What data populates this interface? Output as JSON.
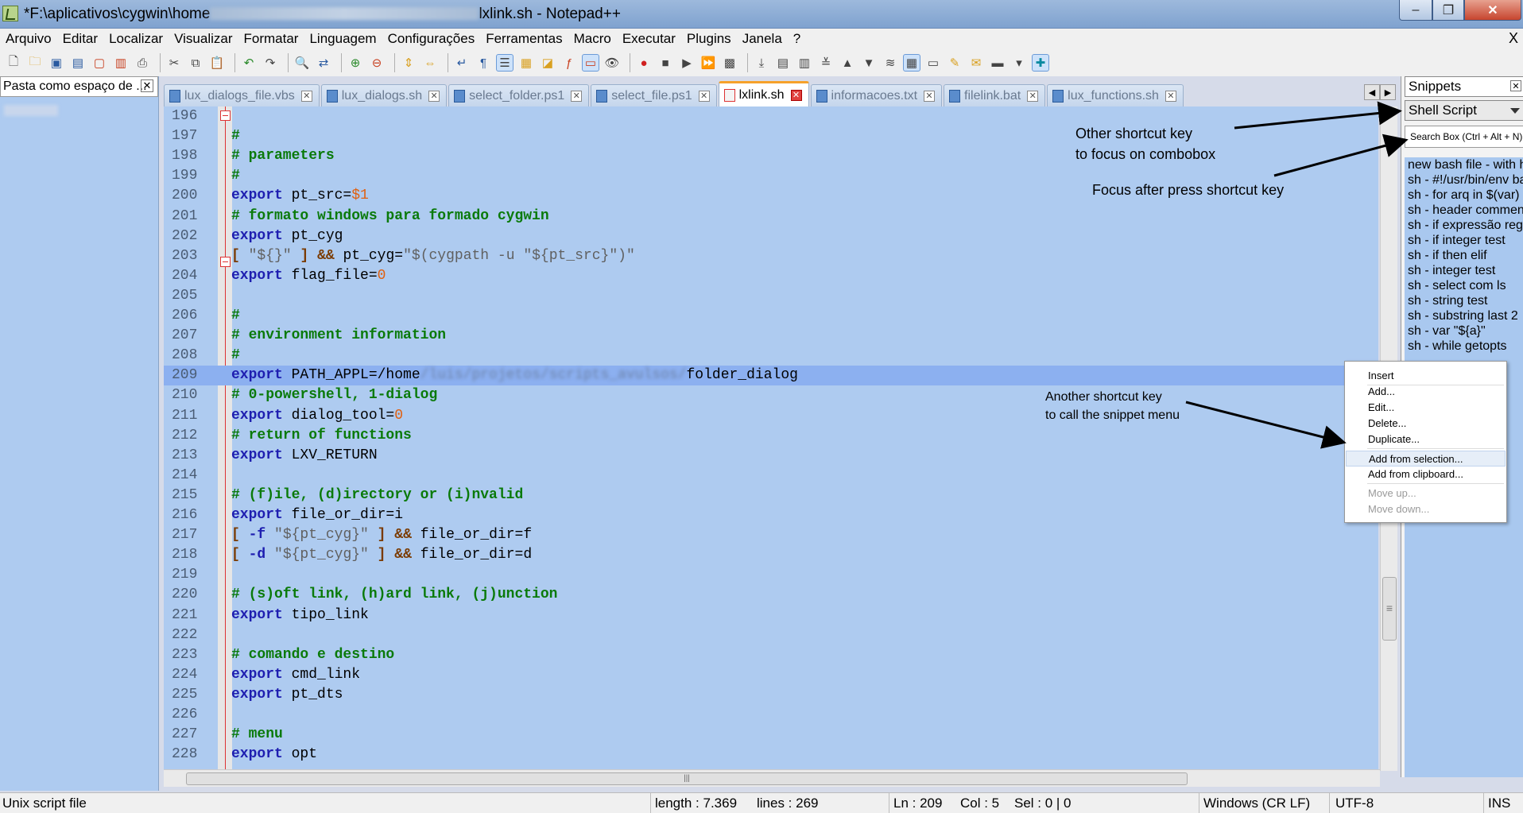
{
  "window": {
    "title_prefix": "*F:\\aplicativos\\cygwin\\home",
    "title_suffix": "lxlink.sh - Notepad++",
    "min": "–",
    "max": "❐",
    "close": "✕"
  },
  "menu": {
    "items": [
      "Arquivo",
      "Editar",
      "Localizar",
      "Visualizar",
      "Formatar",
      "Linguagem",
      "Configurações",
      "Ferramentas",
      "Macro",
      "Executar",
      "Plugins",
      "Janela",
      "?"
    ],
    "close": "X"
  },
  "left_panel": {
    "title": "Pasta como espaço de ...",
    "close": "✕"
  },
  "tabs": [
    {
      "label": "lux_dialogs_file.vbs",
      "active": false
    },
    {
      "label": "lux_dialogs.sh",
      "active": false
    },
    {
      "label": "select_folder.ps1",
      "active": false
    },
    {
      "label": "select_file.ps1",
      "active": false
    },
    {
      "label": "lxlink.sh",
      "active": true
    },
    {
      "label": "informacoes.txt",
      "active": false
    },
    {
      "label": "filelink.bat",
      "active": false
    },
    {
      "label": "lux_functions.sh",
      "active": false
    }
  ],
  "tab_close": "✕",
  "tab_nav": [
    "◀",
    "▶"
  ],
  "editor": {
    "lines": [
      {
        "n": "196",
        "segs": []
      },
      {
        "n": "197",
        "segs": [
          {
            "t": "#",
            "c": "cm"
          }
        ]
      },
      {
        "n": "198",
        "segs": [
          {
            "t": "# parameters",
            "c": "cm"
          }
        ]
      },
      {
        "n": "199",
        "segs": [
          {
            "t": "#",
            "c": "cm"
          }
        ]
      },
      {
        "n": "200",
        "segs": [
          {
            "t": "export",
            "c": "kw"
          },
          {
            "t": " pt_src="
          },
          {
            "t": "$1",
            "c": "nm"
          }
        ]
      },
      {
        "n": "201",
        "segs": [
          {
            "t": "# formato windows para formado cygwin",
            "c": "cm"
          }
        ]
      },
      {
        "n": "202",
        "segs": [
          {
            "t": "export",
            "c": "kw"
          },
          {
            "t": " pt_cyg"
          }
        ]
      },
      {
        "n": "203",
        "segs": [
          {
            "t": "[",
            "c": "op"
          },
          {
            "t": " \"${}\" ",
            "c": "st"
          },
          {
            "t": "]",
            "c": "op"
          },
          {
            "t": " "
          },
          {
            "t": "&&",
            "c": "op"
          },
          {
            "t": " pt_cyg="
          },
          {
            "t": "\"$(cygpath -u \"${pt_src}\")\"",
            "c": "st"
          }
        ]
      },
      {
        "n": "204",
        "segs": [
          {
            "t": "export",
            "c": "kw"
          },
          {
            "t": " flag_file="
          },
          {
            "t": "0",
            "c": "nm"
          }
        ]
      },
      {
        "n": "205",
        "segs": []
      },
      {
        "n": "206",
        "segs": [
          {
            "t": "#",
            "c": "cm"
          }
        ]
      },
      {
        "n": "207",
        "segs": [
          {
            "t": "# environment information",
            "c": "cm"
          }
        ]
      },
      {
        "n": "208",
        "segs": [
          {
            "t": "#",
            "c": "cm"
          }
        ]
      },
      {
        "n": "209",
        "segs": [
          {
            "t": "export",
            "c": "kw"
          },
          {
            "t": " PATH_APPL=/home"
          },
          {
            "t": "/luis/projetos/scripts_avulsos/",
            "c": "blur-txt"
          },
          {
            "t": "folder_dialog"
          }
        ]
      },
      {
        "n": "210",
        "segs": [
          {
            "t": "# 0-powershell, 1-dialog",
            "c": "cm"
          }
        ]
      },
      {
        "n": "211",
        "segs": [
          {
            "t": "export",
            "c": "kw"
          },
          {
            "t": " dialog_tool="
          },
          {
            "t": "0",
            "c": "nm"
          }
        ]
      },
      {
        "n": "212",
        "segs": [
          {
            "t": "# return of functions",
            "c": "cm"
          }
        ]
      },
      {
        "n": "213",
        "segs": [
          {
            "t": "export",
            "c": "kw"
          },
          {
            "t": " LXV_RETURN"
          }
        ]
      },
      {
        "n": "214",
        "segs": []
      },
      {
        "n": "215",
        "segs": [
          {
            "t": "# (f)ile, (d)irectory or (i)nvalid",
            "c": "cm"
          }
        ]
      },
      {
        "n": "216",
        "segs": [
          {
            "t": "export",
            "c": "kw"
          },
          {
            "t": " file_or_dir=i"
          }
        ]
      },
      {
        "n": "217",
        "segs": [
          {
            "t": "[",
            "c": "op"
          },
          {
            "t": " -f ",
            "c": "kw"
          },
          {
            "t": "\"${pt_cyg}\"",
            "c": "st"
          },
          {
            "t": " "
          },
          {
            "t": "]",
            "c": "op"
          },
          {
            "t": " "
          },
          {
            "t": "&&",
            "c": "op"
          },
          {
            "t": " file_or_dir=f"
          }
        ]
      },
      {
        "n": "218",
        "segs": [
          {
            "t": "[",
            "c": "op"
          },
          {
            "t": " -d ",
            "c": "kw"
          },
          {
            "t": "\"${pt_cyg}\"",
            "c": "st"
          },
          {
            "t": " "
          },
          {
            "t": "]",
            "c": "op"
          },
          {
            "t": " "
          },
          {
            "t": "&&",
            "c": "op"
          },
          {
            "t": " file_or_dir=d"
          }
        ]
      },
      {
        "n": "219",
        "segs": []
      },
      {
        "n": "220",
        "segs": [
          {
            "t": "# (s)oft link, (h)ard link, (j)unction",
            "c": "cm"
          }
        ]
      },
      {
        "n": "221",
        "segs": [
          {
            "t": "export",
            "c": "kw"
          },
          {
            "t": " tipo_link"
          }
        ]
      },
      {
        "n": "222",
        "segs": []
      },
      {
        "n": "223",
        "segs": [
          {
            "t": "# comando e destino",
            "c": "cm"
          }
        ]
      },
      {
        "n": "224",
        "segs": [
          {
            "t": "export",
            "c": "kw"
          },
          {
            "t": " cmd_link"
          }
        ]
      },
      {
        "n": "225",
        "segs": [
          {
            "t": "export",
            "c": "kw"
          },
          {
            "t": " pt_dts"
          }
        ]
      },
      {
        "n": "226",
        "segs": []
      },
      {
        "n": "227",
        "segs": [
          {
            "t": "# menu",
            "c": "cm"
          }
        ]
      },
      {
        "n": "228",
        "segs": [
          {
            "t": "export",
            "c": "kw"
          },
          {
            "t": " opt"
          }
        ]
      }
    ]
  },
  "snippets": {
    "title": "Snippets",
    "close": "✕",
    "language": "Shell Script",
    "search_placeholder": "Search Box (Ctrl + Alt + N)",
    "items": [
      "new bash file - with header",
      "sh - #!/usr/bin/env bash",
      "sh - for arq in $(var)",
      "sh - header comment",
      "sh - if expressão regular",
      "sh - if integer test",
      "sh - if then elif",
      "sh - integer test",
      "sh - select com ls",
      "sh - string test",
      "sh - substring last 2",
      "sh - var \"${a}\"",
      "sh - while getopts"
    ]
  },
  "context_menu": {
    "items": [
      {
        "label": "Insert",
        "disabled": false
      },
      {
        "label": "Add...",
        "disabled": false
      },
      {
        "label": "Edit...",
        "disabled": false
      },
      {
        "label": "Delete...",
        "disabled": false
      },
      {
        "label": "Duplicate...",
        "disabled": false
      },
      {
        "label": "Add from selection...",
        "disabled": false
      },
      {
        "label": "Add from clipboard...",
        "disabled": false
      },
      {
        "label": "Move up...",
        "disabled": true
      },
      {
        "label": "Move down...",
        "disabled": true
      }
    ]
  },
  "annotations": {
    "shortcut_combobox_1": "Other shortcut key",
    "shortcut_combobox_2": "to focus on combobox",
    "focus_after": "Focus after press shortcut key",
    "snippet_menu_1": "Another shortcut key",
    "snippet_menu_2": "to call the snippet menu"
  },
  "hscroll_grip": "|||",
  "vscroll_grip": "≡",
  "status": {
    "file_type": "Unix script file",
    "length": "length : 7.369",
    "lines": "lines : 269",
    "ln": "Ln : 209",
    "col": "Col : 5",
    "sel": "Sel : 0 | 0",
    "eol": "Windows (CR LF)",
    "encoding": "UTF-8",
    "mode": "INS"
  },
  "colors": {
    "editor_bg": "#aecbf0",
    "current_line": "#8cb0f0",
    "keyword": "#1e1eb0",
    "comment": "#0a7a0a",
    "active_tab_accent": "#f6a12a"
  }
}
